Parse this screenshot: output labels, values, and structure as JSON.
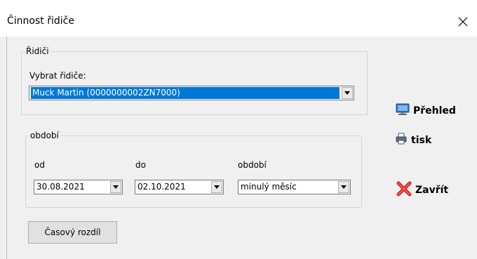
{
  "window": {
    "title": "Činnost řidiče"
  },
  "drivers_group": {
    "legend": "Řidiči",
    "select_label": "Vybrat řidiče:",
    "selected_driver": "Muck Martin (0000000002ZN7000)"
  },
  "period_group": {
    "legend": "období",
    "from_label": "od",
    "from_value": "30.08.2021",
    "to_label": "do",
    "to_value": "02.10.2021",
    "period_label": "období",
    "period_value": "minulý měsíc"
  },
  "buttons": {
    "time_diff": "Časový rozdíl",
    "overview": "Přehled",
    "print": "tisk",
    "close": "Zavřít"
  },
  "icons": {
    "overview": "monitor-icon",
    "print": "printer-icon",
    "close": "red-x-icon",
    "window_close": "close-icon"
  }
}
